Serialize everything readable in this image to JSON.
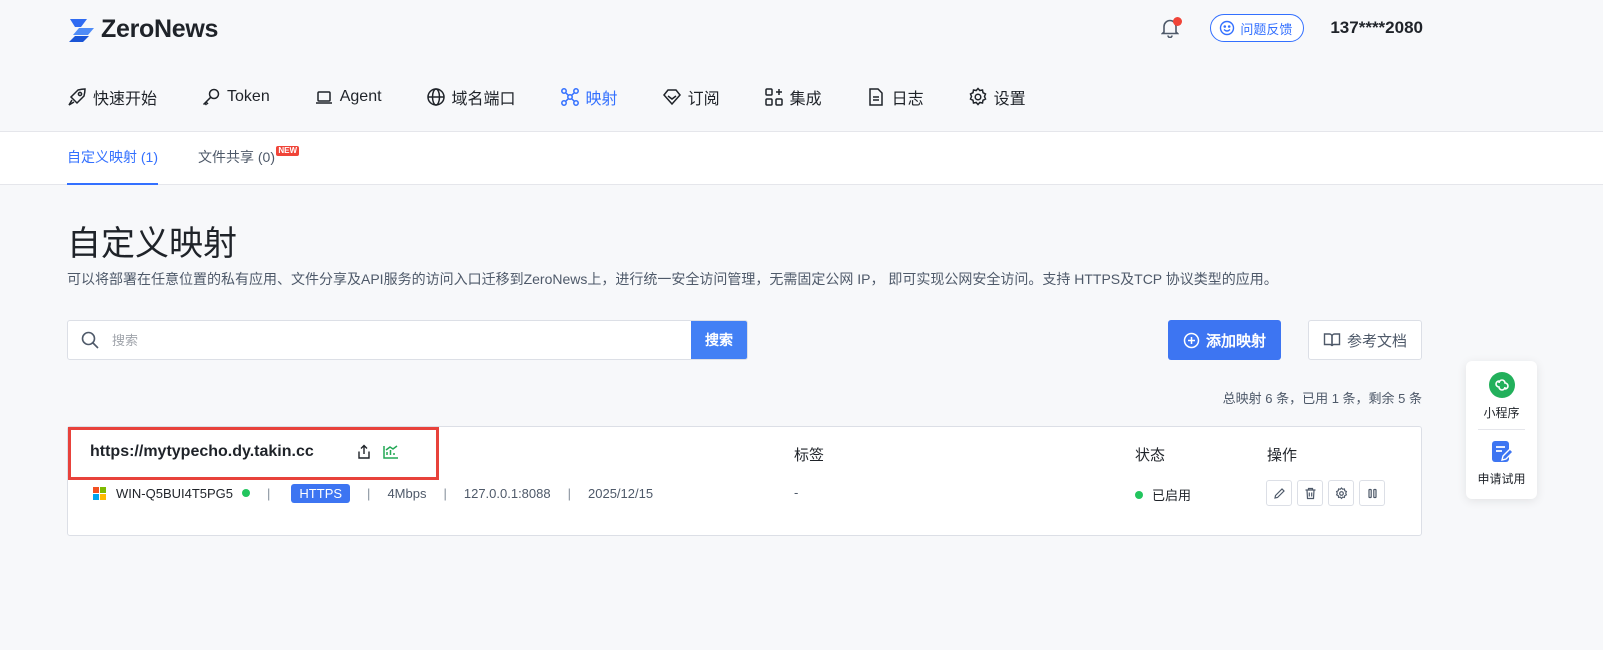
{
  "brand": {
    "name": "ZeroNews"
  },
  "header": {
    "feedback_label": "问题反馈",
    "user": "137****2080"
  },
  "nav": {
    "items": [
      {
        "label": "快速开始",
        "icon": "rocket-icon"
      },
      {
        "label": "Token",
        "icon": "key-icon"
      },
      {
        "label": "Agent",
        "icon": "laptop-icon"
      },
      {
        "label": "域名端口",
        "icon": "globe-icon"
      },
      {
        "label": "映射",
        "icon": "mapping-icon",
        "active": true
      },
      {
        "label": "订阅",
        "icon": "diamond-icon"
      },
      {
        "label": "集成",
        "icon": "apps-icon"
      },
      {
        "label": "日志",
        "icon": "document-icon"
      },
      {
        "label": "设置",
        "icon": "gear-icon"
      }
    ]
  },
  "subtabs": {
    "custom": "自定义映射 (1)",
    "fileshare": "文件共享 (0)",
    "new_badge": "NEW"
  },
  "page": {
    "title": "自定义映射",
    "description": "可以将部署在任意位置的私有应用、文件分享及API服务的访问入口迁移到ZeroNews上，进行统一安全访问管理，无需固定公网 IP， 即可实现公网安全访问。支持 HTTPS及TCP 协议类型的应用。"
  },
  "search": {
    "placeholder": "搜索",
    "button": "搜索"
  },
  "actions": {
    "add": "添加映射",
    "docs": "参考文档"
  },
  "quota": "总映射 6 条，已用 1 条，剩余 5 条",
  "table": {
    "col_tag": "标签",
    "col_status": "状态",
    "col_ops": "操作"
  },
  "mapping": {
    "url": "https://mytypecho.dy.takin.cc",
    "host": "WIN-Q5BUI4T5PG5",
    "protocol": "HTTPS",
    "bandwidth": "4Mbps",
    "target": "127.0.0.1:8088",
    "date": "2025/12/15",
    "tag": "-",
    "status": "已启用",
    "sep": "|"
  },
  "float_panel": {
    "miniprogram": "小程序",
    "trial": "申请试用"
  },
  "colors": {
    "primary": "#3d75f2",
    "status_green": "#22c55e",
    "highlight_red": "#e8423b",
    "notify_red": "#f04438"
  }
}
